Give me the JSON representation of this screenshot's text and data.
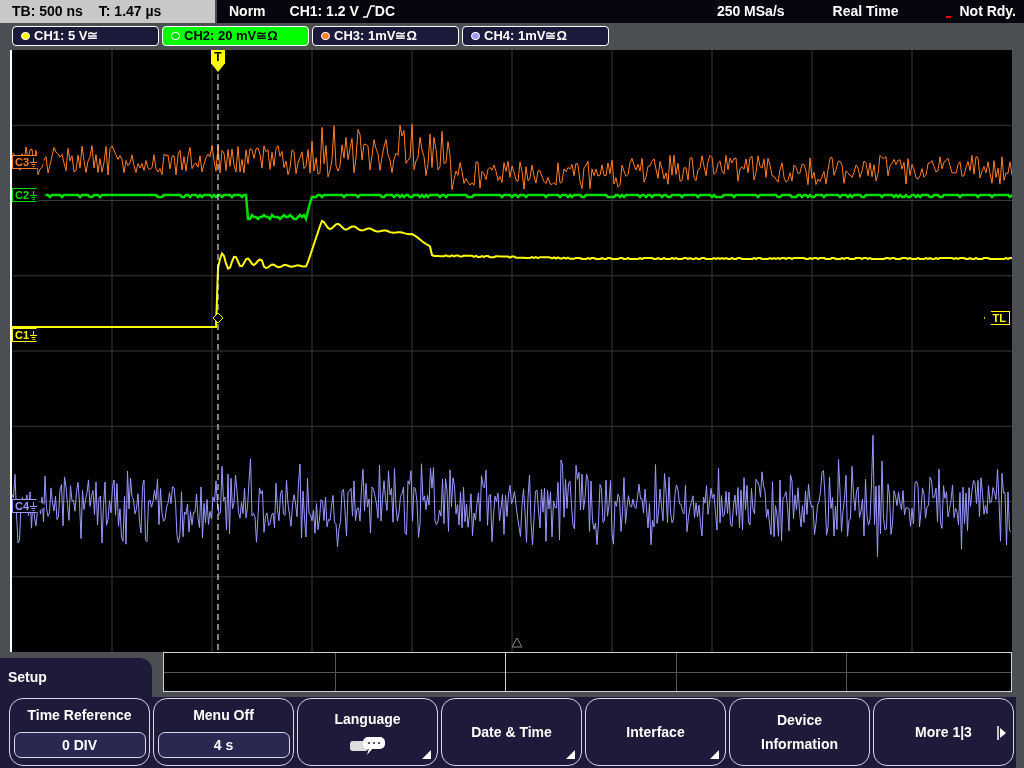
{
  "status_bar": {
    "timebase": "TB: 500 ns",
    "trigger_time": "T: 1.47 µs",
    "mode": "Norm",
    "trigger_source": "CH1: 1.2 V",
    "trigger_coupling": "DC",
    "sample_rate": "250 MSa/s",
    "acquisition": "Real Time",
    "state": "Not Rdy."
  },
  "channels": [
    {
      "label": "CH1: 5 V≅",
      "color": "#ffff00",
      "selected": false
    },
    {
      "label": "CH2: 20 mV≅Ω",
      "color": "#00e000",
      "selected": true
    },
    {
      "label": "CH3: 1mV≅Ω",
      "color": "#ff7f27",
      "selected": false
    },
    {
      "label": "CH4: 1mV≅Ω",
      "color": "#9a9aff",
      "selected": false
    }
  ],
  "markers": [
    {
      "label": "C3"
    },
    {
      "label": "C2"
    },
    {
      "label": "C1"
    },
    {
      "label": "C4"
    }
  ],
  "trigger_level": {
    "label": "TL"
  },
  "trigger_position": {
    "label": "T"
  },
  "menu": {
    "title": "Setup",
    "buttons": [
      {
        "kind": "value",
        "label": "Time Reference",
        "value": "0 DIV",
        "submenu": false
      },
      {
        "kind": "value",
        "label": "Menu Off",
        "value": "4 s",
        "submenu": false
      },
      {
        "kind": "language",
        "label": "Language",
        "submenu": true
      },
      {
        "kind": "plain",
        "label": "Date & Time",
        "submenu": true
      },
      {
        "kind": "plain",
        "label": "Interface",
        "submenu": true
      },
      {
        "kind": "plain",
        "label": "Device Information",
        "submenu": false
      },
      {
        "kind": "next",
        "label": "More 1|3",
        "submenu": false
      }
    ]
  }
}
